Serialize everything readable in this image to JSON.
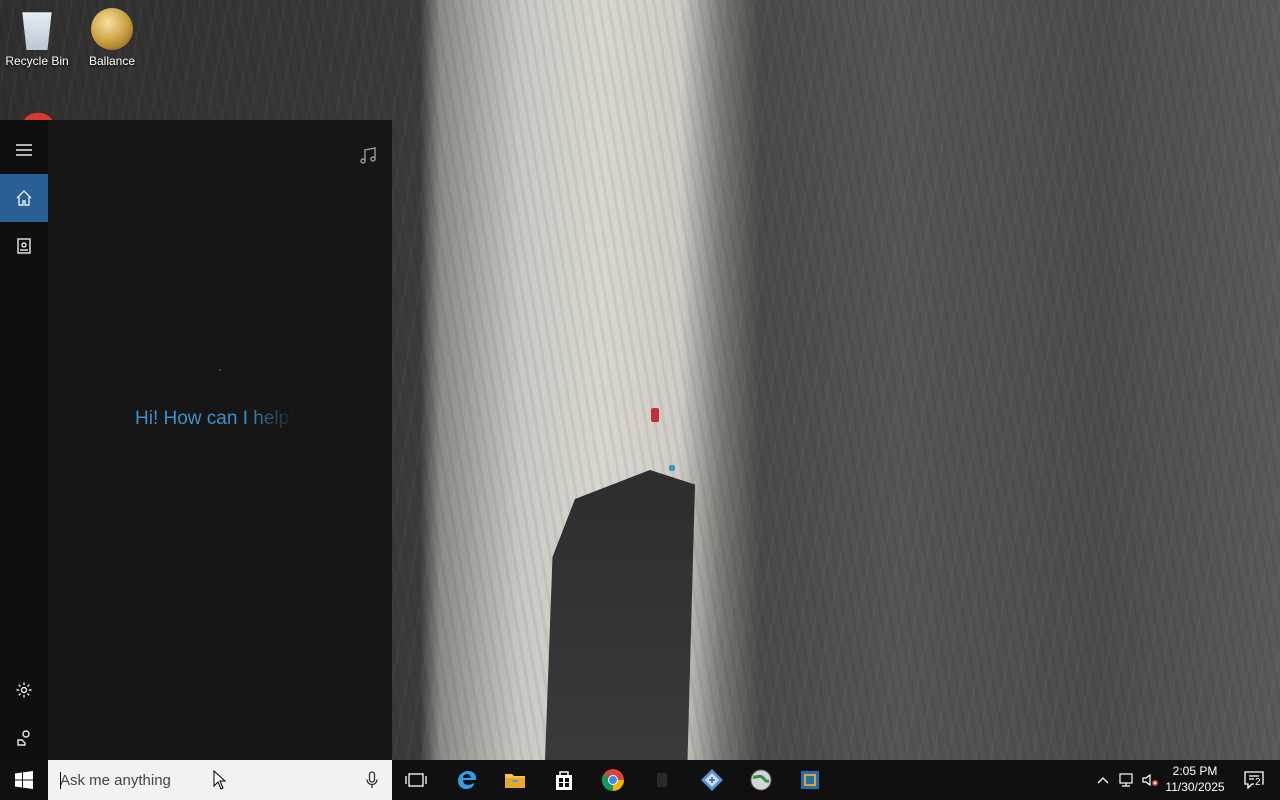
{
  "desktop": {
    "icons": [
      {
        "label": "Recycle Bin"
      },
      {
        "label": "Ballance"
      }
    ]
  },
  "cortana": {
    "greeting": "Hi! How can I help?",
    "rail": {
      "menu": "hamburger-menu-icon",
      "home": "home-icon",
      "notebook": "notebook-icon",
      "settings": "gear-icon",
      "feedback": "feedback-icon"
    },
    "music_icon": "music-note-icon"
  },
  "taskbar": {
    "search": {
      "placeholder": "Ask me anything"
    },
    "apps": [
      {
        "name": "task-view-icon"
      },
      {
        "name": "edge-icon"
      },
      {
        "name": "file-explorer-icon"
      },
      {
        "name": "store-icon"
      },
      {
        "name": "chrome-icon"
      },
      {
        "name": "unknown-app-icon"
      },
      {
        "name": "diamond-app-icon"
      },
      {
        "name": "globe-app-icon"
      },
      {
        "name": "virtualbox-icon"
      }
    ],
    "tray": {
      "time": "2:05 PM",
      "date": "11/30/2025",
      "notification_count": "2"
    }
  },
  "colors": {
    "accent": "#2a5f95",
    "greeting": "#3e8fc8",
    "taskbar": "#101010",
    "panel": "#161616"
  }
}
